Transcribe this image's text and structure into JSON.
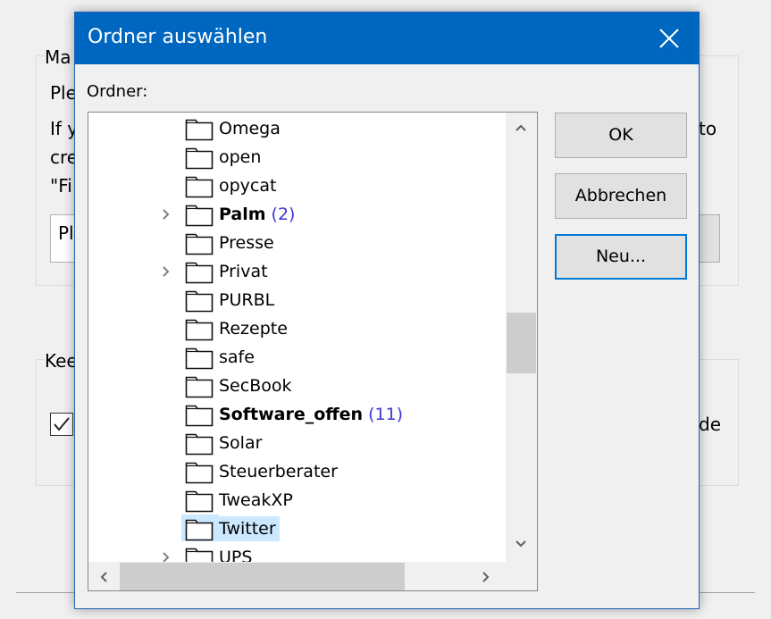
{
  "background": {
    "group1_label": "Ma",
    "line1": "Ple",
    "line2_left": "If y",
    "line2_right": "to",
    "line3": "cre",
    "line4": "\"Fi",
    "input_value": "Pl",
    "group2_label": "Kee",
    "checkbox_right_text": "de",
    "checkbox_checked": true
  },
  "dialog": {
    "title": "Ordner auswählen",
    "close_icon": "close-icon",
    "folder_label": "Ordner:",
    "buttons": {
      "ok": "OK",
      "cancel": "Abbrechen",
      "new": "Neu..."
    },
    "tree_items": [
      {
        "name": "Omega",
        "bold": false,
        "expandable": false,
        "count": ""
      },
      {
        "name": "open",
        "bold": false,
        "expandable": false,
        "count": ""
      },
      {
        "name": "opycat",
        "bold": false,
        "expandable": false,
        "count": ""
      },
      {
        "name": "Palm",
        "bold": true,
        "expandable": true,
        "count": "(2)"
      },
      {
        "name": "Presse",
        "bold": false,
        "expandable": false,
        "count": ""
      },
      {
        "name": "Privat",
        "bold": false,
        "expandable": true,
        "count": ""
      },
      {
        "name": "PURBL",
        "bold": false,
        "expandable": false,
        "count": ""
      },
      {
        "name": "Rezepte",
        "bold": false,
        "expandable": false,
        "count": ""
      },
      {
        "name": "safe",
        "bold": false,
        "expandable": false,
        "count": ""
      },
      {
        "name": "SecBook",
        "bold": false,
        "expandable": false,
        "count": ""
      },
      {
        "name": "Software_offen",
        "bold": true,
        "expandable": false,
        "count": "(11)"
      },
      {
        "name": "Solar",
        "bold": false,
        "expandable": false,
        "count": ""
      },
      {
        "name": "Steuerberater",
        "bold": false,
        "expandable": false,
        "count": ""
      },
      {
        "name": "TweakXP",
        "bold": false,
        "expandable": false,
        "count": ""
      },
      {
        "name": "Twitter",
        "bold": false,
        "expandable": false,
        "count": "",
        "selected": true
      },
      {
        "name": "UPS",
        "bold": false,
        "expandable": true,
        "count": ""
      }
    ]
  },
  "colors": {
    "titlebar": "#0067c0",
    "selection": "#cce8ff",
    "count_text": "#3b37d6",
    "focus_border": "#0078d7"
  }
}
